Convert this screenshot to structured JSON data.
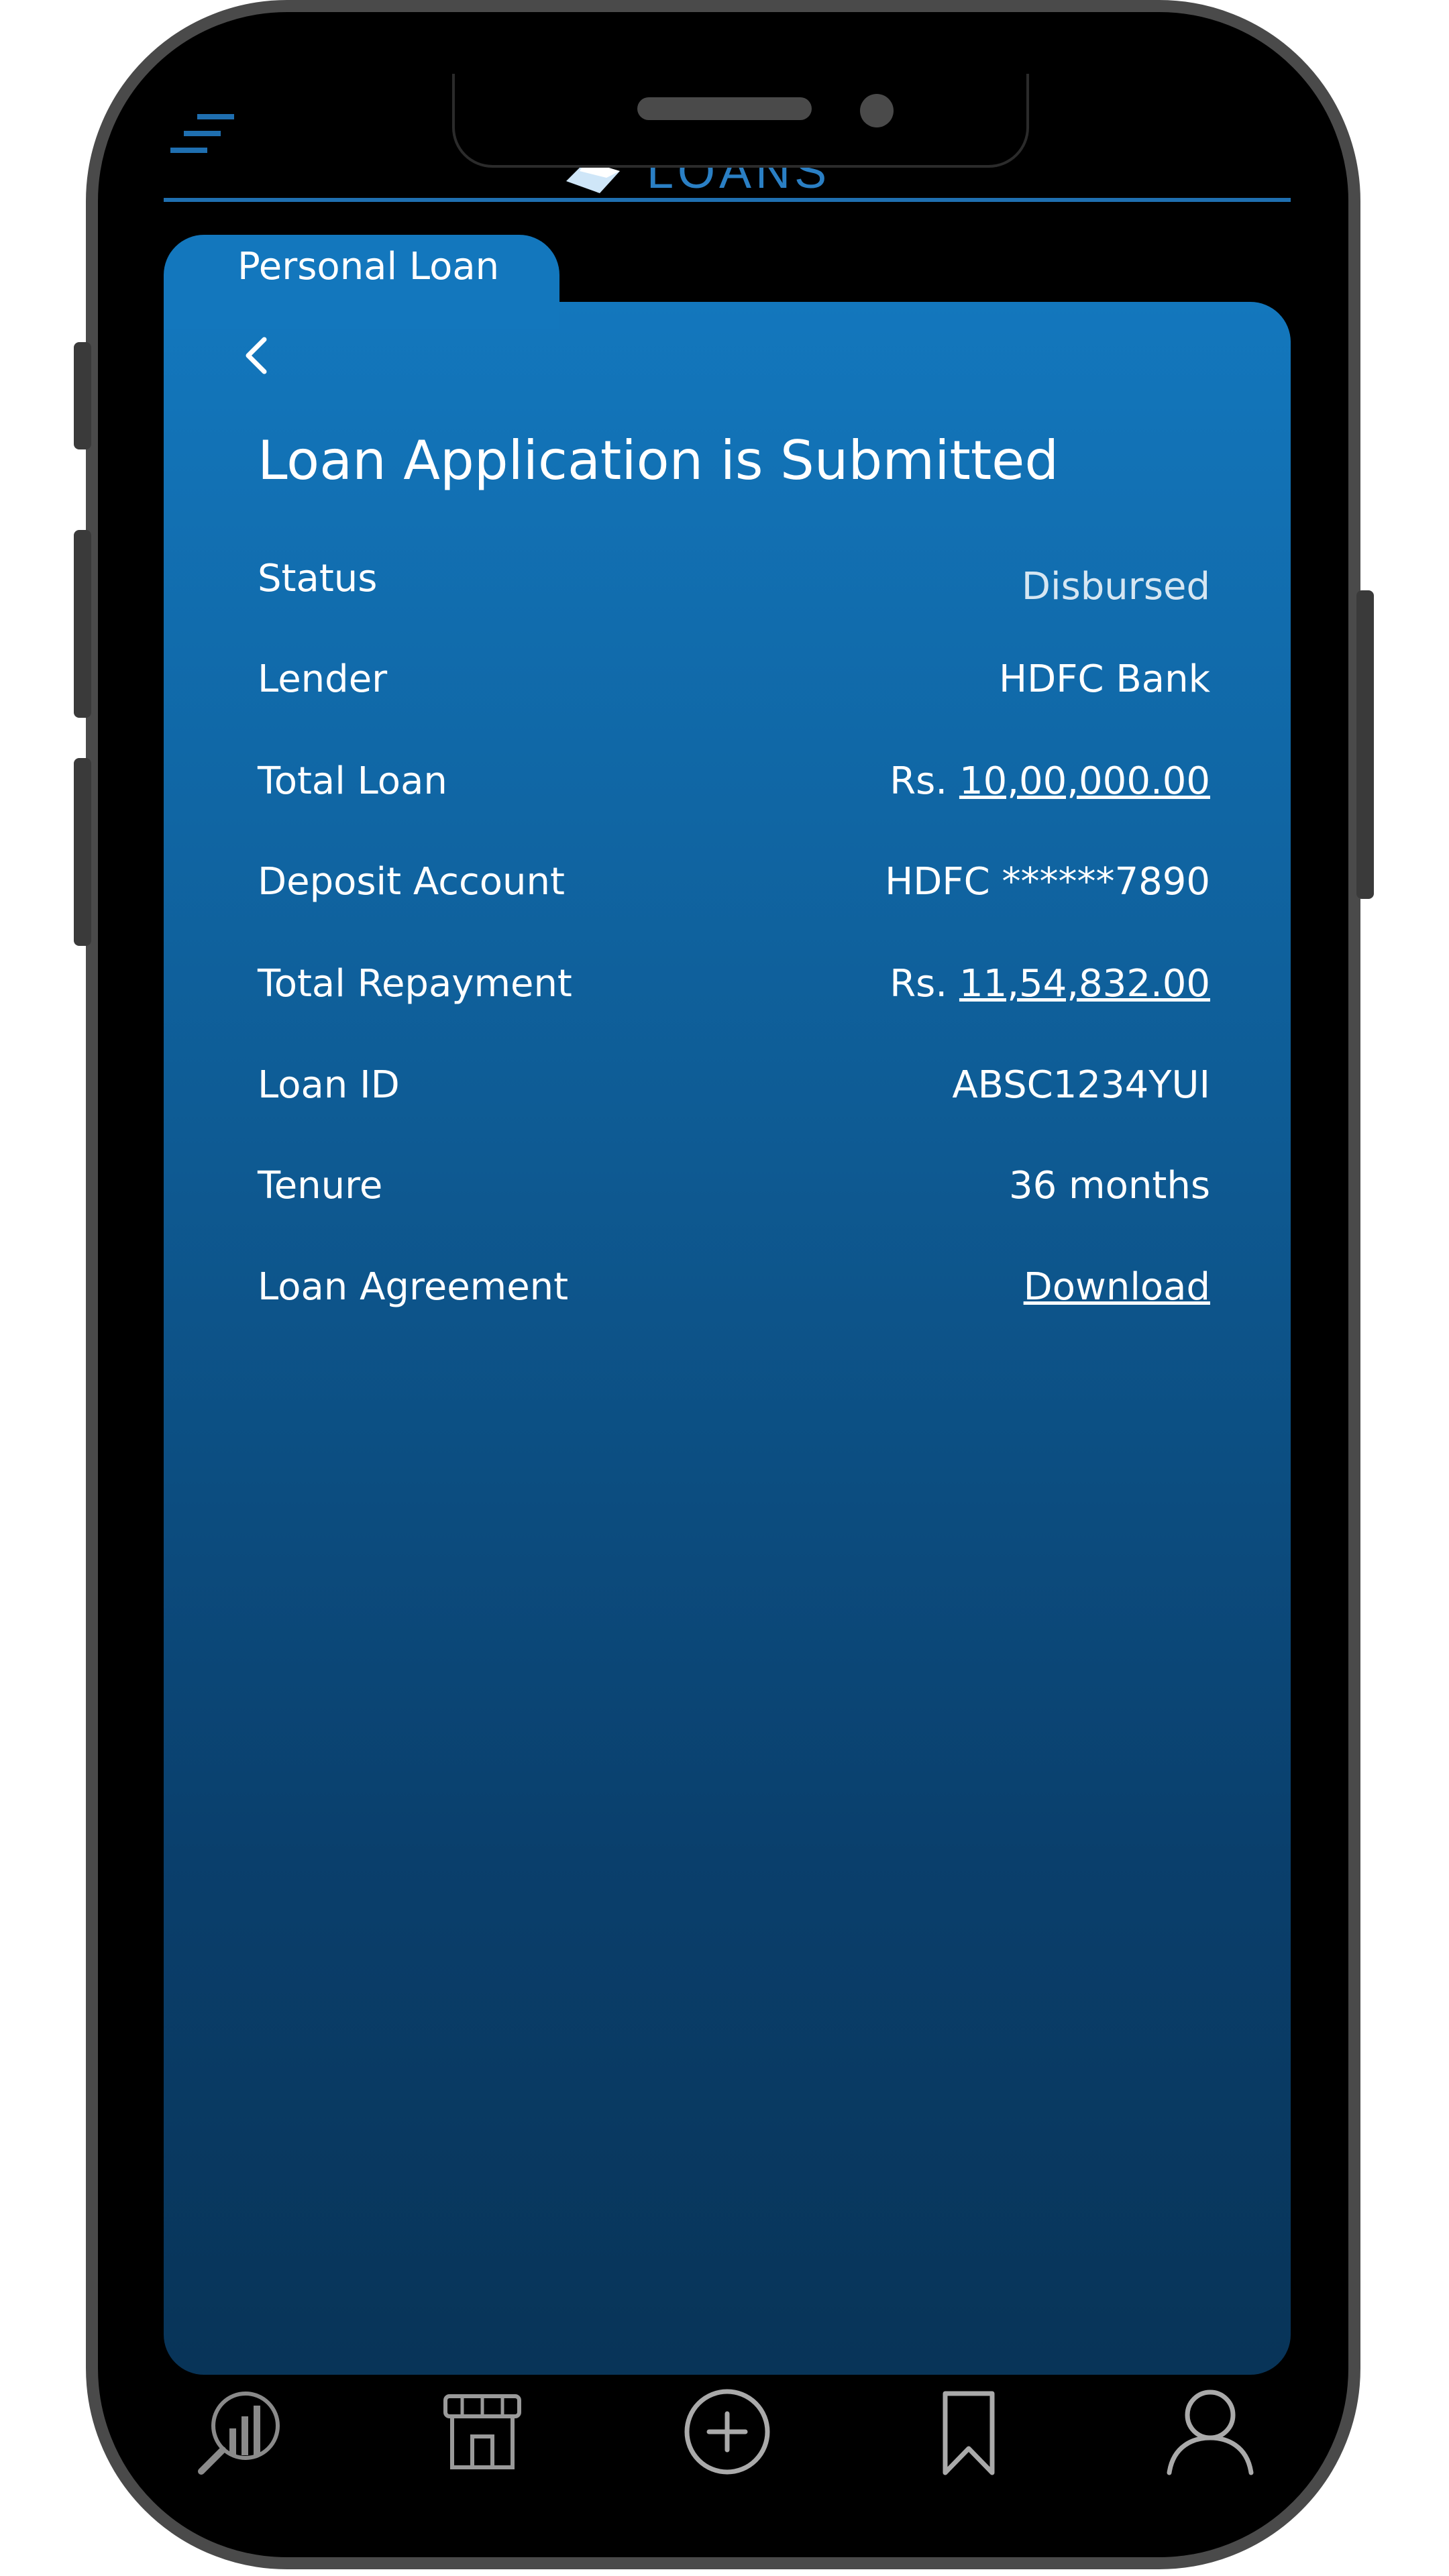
{
  "header": {
    "logo_text": "LOANS"
  },
  "tab": {
    "label": "Personal Loan"
  },
  "page": {
    "title": "Loan Application is Submitted"
  },
  "details": [
    {
      "label": "Status",
      "value": "Disbursed"
    },
    {
      "label": "Lender",
      "value": "HDFC Bank"
    },
    {
      "label": "Total Loan",
      "prefix": "Rs. ",
      "value": "10,00,000.00"
    },
    {
      "label": "Deposit Account",
      "value": "HDFC ******7890"
    },
    {
      "label": "Total Repayment",
      "prefix": "Rs. ",
      "value": "11,54,832.00"
    },
    {
      "label": "Loan ID",
      "value": "ABSC1234YUI"
    },
    {
      "label": "Tenure",
      "value": "36 months"
    },
    {
      "label": "Loan Agreement",
      "value": "Download"
    }
  ],
  "bottom_nav": [
    {
      "icon": "analytics-search-icon"
    },
    {
      "icon": "store-icon"
    },
    {
      "icon": "add-circle-icon"
    },
    {
      "icon": "bookmark-icon"
    },
    {
      "icon": "profile-icon"
    }
  ],
  "colors": {
    "card_top": "#1377bd",
    "card_bottom": "#083458",
    "accent_line": "#1f6fb0"
  }
}
